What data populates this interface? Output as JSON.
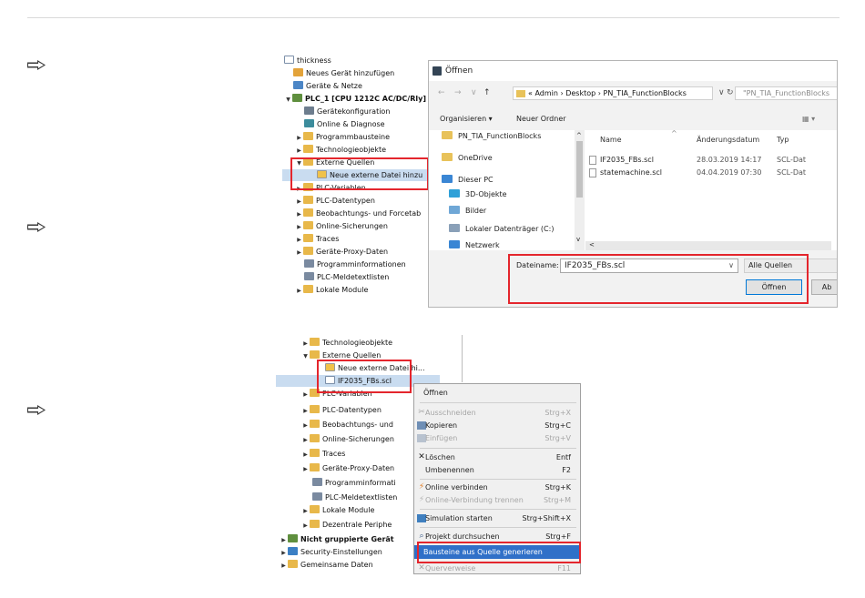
{
  "colors": {
    "highlight": "#e4262d",
    "selection": "#c9dcf0",
    "menu_highlight": "#3070c8"
  },
  "step_arrows": [
    "arrow-right-icon",
    "arrow-right-icon",
    "arrow-right-icon"
  ],
  "tree1": {
    "rows": [
      {
        "label": "thickness",
        "icon": "document-icon"
      },
      {
        "label": "Neues Gerät hinzufügen",
        "icon": "add-device-icon"
      },
      {
        "label": "Geräte & Netze",
        "icon": "network-icon"
      },
      {
        "label": "PLC_1 [CPU 1212C AC/DC/Rly]",
        "icon": "plc-icon"
      },
      {
        "label": "Gerätekonfiguration",
        "icon": "device-config-icon"
      },
      {
        "label": "Online & Diagnose",
        "icon": "diagnose-icon"
      },
      {
        "label": "Programmbausteine",
        "icon": "folder-icon"
      },
      {
        "label": "Technologieobjekte",
        "icon": "folder-icon"
      },
      {
        "label": "Externe Quellen",
        "icon": "folder-icon"
      },
      {
        "label": "Neue externe Datei hinzu",
        "icon": "add-file-icon"
      },
      {
        "label": "PLC-Variablen",
        "icon": "folder-icon"
      },
      {
        "label": "PLC-Datentypen",
        "icon": "folder-icon"
      },
      {
        "label": "Beobachtungs- und Forcetab",
        "icon": "folder-icon"
      },
      {
        "label": "Online-Sicherungen",
        "icon": "folder-icon"
      },
      {
        "label": "Traces",
        "icon": "folder-icon"
      },
      {
        "label": "Geräte-Proxy-Daten",
        "icon": "folder-icon"
      },
      {
        "label": "Programminformationen",
        "icon": "program-info-icon"
      },
      {
        "label": "PLC-Meldetextlisten",
        "icon": "text-list-icon"
      },
      {
        "label": "Lokale Module",
        "icon": "folder-icon"
      }
    ]
  },
  "dialog": {
    "title": "Öffnen",
    "breadcrumb": "« Admin  ›  Desktop  ›  PN_TIA_FunctionBlocks",
    "search_placeholder": "\"PN_TIA_FunctionBlocks",
    "toolbar": {
      "organize": "Organisieren ▾",
      "new_folder": "Neuer Ordner"
    },
    "nav_items": [
      "PN_TIA_FunctionBlocks",
      "OneDrive",
      "Dieser PC",
      "3D-Objekte",
      "Bilder",
      "Lokaler Datenträger (C:)",
      "Netzwerk"
    ],
    "columns": {
      "name": "Name",
      "date": "Änderungsdatum",
      "type": "Typ"
    },
    "files": [
      {
        "name": "IF2035_FBs.scl",
        "date": "28.03.2019 14:17",
        "type": "SCL-Dat"
      },
      {
        "name": "statemachine.scl",
        "date": "04.04.2019 07:30",
        "type": "SCL-Dat"
      }
    ],
    "filename_label": "Dateiname:",
    "filename_value": "IF2035_FBs.scl",
    "filter_value": "Alle Quellen",
    "open_button": "Öffnen",
    "cancel_button": "Ab"
  },
  "tree2": {
    "rows": [
      {
        "label": "Technologieobjekte",
        "icon": "folder-icon"
      },
      {
        "label": "Externe Quellen",
        "icon": "folder-icon"
      },
      {
        "label": "Neue externe Datei hi...",
        "icon": "add-file-icon"
      },
      {
        "label": "IF2035_FBs.scl",
        "icon": "document-icon"
      },
      {
        "label": "PLC-Variablen",
        "icon": "folder-icon"
      },
      {
        "label": "PLC-Datentypen",
        "icon": "folder-icon"
      },
      {
        "label": "Beobachtungs- und",
        "icon": "folder-icon"
      },
      {
        "label": "Online-Sicherungen",
        "icon": "folder-icon"
      },
      {
        "label": "Traces",
        "icon": "folder-icon"
      },
      {
        "label": "Geräte-Proxy-Daten",
        "icon": "folder-icon"
      },
      {
        "label": "Programminformati",
        "icon": "program-info-icon"
      },
      {
        "label": "PLC-Meldetextlisten",
        "icon": "text-list-icon"
      },
      {
        "label": "Lokale Module",
        "icon": "folder-icon"
      },
      {
        "label": "Dezentrale Periphe",
        "icon": "folder-icon"
      },
      {
        "label": "Nicht gruppierte Gerät",
        "icon": "device-icon"
      },
      {
        "label": "Security-Einstellungen",
        "icon": "security-icon"
      },
      {
        "label": "Gemeinsame Daten",
        "icon": "folder-icon"
      }
    ]
  },
  "context_menu": {
    "items": [
      {
        "label": "Öffnen",
        "shortcut": "",
        "icon": "",
        "disabled": false
      },
      {
        "label": "Ausschneiden",
        "shortcut": "Strg+X",
        "icon": "cut-icon",
        "disabled": true
      },
      {
        "label": "Kopieren",
        "shortcut": "Strg+C",
        "icon": "copy-icon",
        "disabled": false
      },
      {
        "label": "Einfügen",
        "shortcut": "Strg+V",
        "icon": "paste-icon",
        "disabled": true
      },
      {
        "label": "Löschen",
        "shortcut": "Entf",
        "icon": "delete-icon",
        "disabled": false
      },
      {
        "label": "Umbenennen",
        "shortcut": "F2",
        "icon": "",
        "disabled": false
      },
      {
        "label": "Online verbinden",
        "shortcut": "Strg+K",
        "icon": "connect-online-icon",
        "disabled": false
      },
      {
        "label": "Online-Verbindung trennen",
        "shortcut": "Strg+M",
        "icon": "disconnect-online-icon",
        "disabled": true
      },
      {
        "label": "Simulation starten",
        "shortcut": "Strg+Shift+X",
        "icon": "simulation-icon",
        "disabled": false
      },
      {
        "label": "Projekt durchsuchen",
        "shortcut": "Strg+F",
        "icon": "search-project-icon",
        "disabled": false
      },
      {
        "label": "Bausteine aus Quelle generieren",
        "shortcut": "",
        "icon": "",
        "disabled": false
      },
      {
        "label": "Querverweise",
        "shortcut": "F11",
        "icon": "cross-reference-icon",
        "disabled": true
      }
    ]
  }
}
